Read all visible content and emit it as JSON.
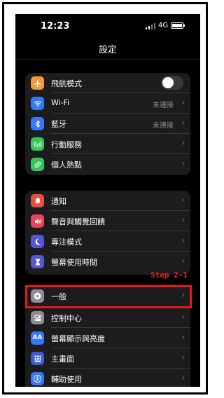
{
  "status_bar": {
    "time": "12:23",
    "network": "4G",
    "battery_level": 1.0
  },
  "header": {
    "title": "設定"
  },
  "groups": [
    {
      "items": [
        {
          "label": "飛航模式",
          "icon": "airplane-icon",
          "color": "#f09a37",
          "control": "toggle",
          "toggle_on": false
        },
        {
          "label": "Wi-Fi",
          "icon": "wifi-icon",
          "color": "#3478f6",
          "value": "未連接"
        },
        {
          "label": "藍牙",
          "icon": "bluetooth-icon",
          "color": "#3478f6",
          "value": "未連接"
        },
        {
          "label": "行動服務",
          "icon": "antenna-icon",
          "color": "#34c759"
        },
        {
          "label": "個人熱點",
          "icon": "link-icon",
          "color": "#34c759"
        }
      ]
    },
    {
      "items": [
        {
          "label": "通知",
          "icon": "bell-icon",
          "color": "#eb4e3d"
        },
        {
          "label": "聲音與觸覺回饋",
          "icon": "speaker-icon",
          "color": "#eb445a"
        },
        {
          "label": "專注模式",
          "icon": "moon-icon",
          "color": "#5856d6"
        },
        {
          "label": "螢幕使用時間",
          "icon": "hourglass-icon",
          "color": "#5856d6"
        }
      ]
    },
    {
      "items": [
        {
          "label": "一般",
          "icon": "gear-icon",
          "color": "#8e8e93"
        },
        {
          "label": "控制中心",
          "icon": "toggles-icon",
          "color": "#8e8e93"
        },
        {
          "label": "螢幕顯示與亮度",
          "icon": "text-size-icon",
          "color": "#3478f6"
        },
        {
          "label": "主畫面",
          "icon": "grid-icon",
          "color": "#3f5bd8"
        },
        {
          "label": "輔助使用",
          "icon": "accessibility-icon",
          "color": "#3478f6"
        }
      ]
    }
  ],
  "annotation": {
    "step_label": "Step 2-1",
    "color": "#e8181a"
  }
}
